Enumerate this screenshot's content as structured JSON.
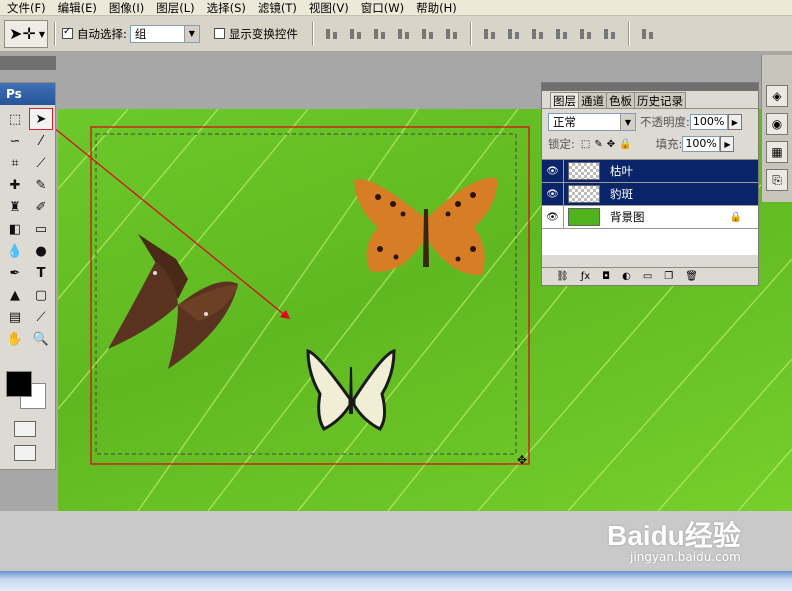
{
  "menubar": {
    "items": [
      "文件(F)",
      "编辑(E)",
      "图像(I)",
      "图层(L)",
      "选择(S)",
      "滤镜(T)",
      "视图(V)",
      "窗口(W)",
      "帮助(H)"
    ]
  },
  "options": {
    "tool_icon": "move-tool-icon",
    "auto_select_label": "自动选择:",
    "auto_select_checked": true,
    "auto_select_value": "组",
    "show_transform_label": "显示变换控件",
    "show_transform_checked": false
  },
  "toolbox": {
    "logo": "Ps",
    "tools": [
      "marquee",
      "move",
      "lasso",
      "magic-wand",
      "crop",
      "slice",
      "healing-brush",
      "brush",
      "clone-stamp",
      "history-brush",
      "eraser",
      "gradient",
      "blur",
      "dodge",
      "pen",
      "type",
      "path-select",
      "shape",
      "notes",
      "eyedropper",
      "hand",
      "zoom"
    ],
    "type_tool_glyph": "T",
    "foreground_color": "#000000",
    "background_color": "#ffffff"
  },
  "layers_panel": {
    "tabs": [
      "图层",
      "通道",
      "色板",
      "历史记录"
    ],
    "blend_mode": "正常",
    "opacity_label": "不透明度:",
    "opacity_value": "100%",
    "lock_label": "锁定:",
    "fill_label": "填充:",
    "fill_value": "100%",
    "layers": [
      {
        "name": "枯叶",
        "selected": true,
        "thumb": "checker"
      },
      {
        "name": "豹斑",
        "selected": true,
        "thumb": "checker"
      },
      {
        "name": "背景图",
        "selected": false,
        "thumb": "green",
        "locked": true
      }
    ]
  },
  "canvas": {
    "background": "green leaf",
    "objects": [
      "dead-leaf-butterfly",
      "leopard-butterfly",
      "swallowtail-butterfly"
    ]
  },
  "watermark": {
    "main": "Baidu经验",
    "sub": "jingyan.baidu.com"
  },
  "colors": {
    "selection_red": "#e0001b",
    "layer_selected": "#0a246a",
    "leaf_green": "#6cc92a"
  }
}
